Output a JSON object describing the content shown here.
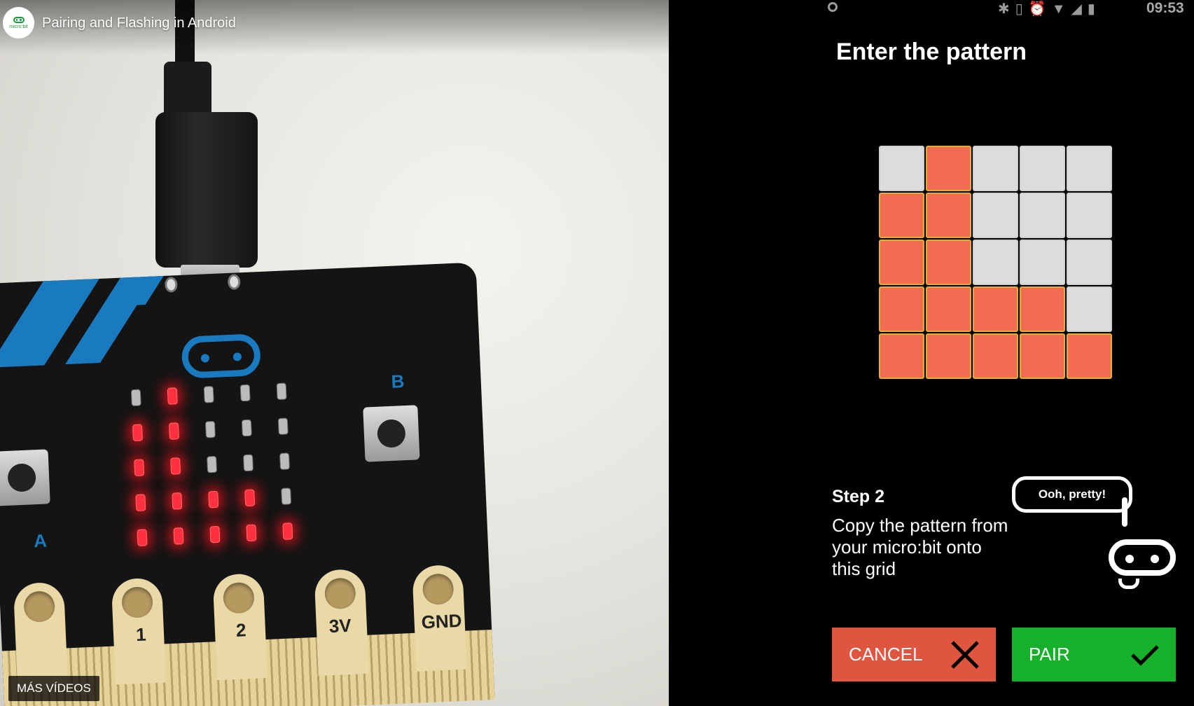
{
  "video": {
    "title": "Pairing and Flashing in Android",
    "channel_logo_text": "micro:bit",
    "more_videos_label": "MÁS VÍDEOS",
    "board_labels": {
      "button_a": "A",
      "button_b": "B",
      "pin_1": "1",
      "pin_2": "2",
      "pin_3v": "3V",
      "pin_gnd": "GND"
    },
    "led_pattern": [
      [
        0,
        1,
        0,
        0,
        0
      ],
      [
        1,
        1,
        0,
        0,
        0
      ],
      [
        1,
        1,
        0,
        0,
        0
      ],
      [
        1,
        1,
        1,
        1,
        0
      ],
      [
        1,
        1,
        1,
        1,
        1
      ]
    ]
  },
  "status_bar": {
    "time": "09:53",
    "icons": [
      "bluetooth-icon",
      "vibrate-icon",
      "alarm-icon",
      "wifi-icon",
      "signal-4g-icon",
      "battery-icon"
    ]
  },
  "pairing": {
    "title": "Enter the pattern",
    "grid": [
      [
        0,
        1,
        0,
        0,
        0
      ],
      [
        1,
        1,
        0,
        0,
        0
      ],
      [
        1,
        1,
        0,
        0,
        0
      ],
      [
        1,
        1,
        1,
        1,
        0
      ],
      [
        1,
        1,
        1,
        1,
        1
      ]
    ],
    "step_title": "Step 2",
    "step_text": "Copy the pattern from your micro:bit onto this grid",
    "speech_bubble": "Ooh, pretty!",
    "cancel_label": "CANCEL",
    "pair_label": "PAIR"
  },
  "colors": {
    "cell_on": "#f36b53",
    "cell_off": "#dcdcdc",
    "cancel": "#e0553f",
    "pair": "#15b12b"
  }
}
